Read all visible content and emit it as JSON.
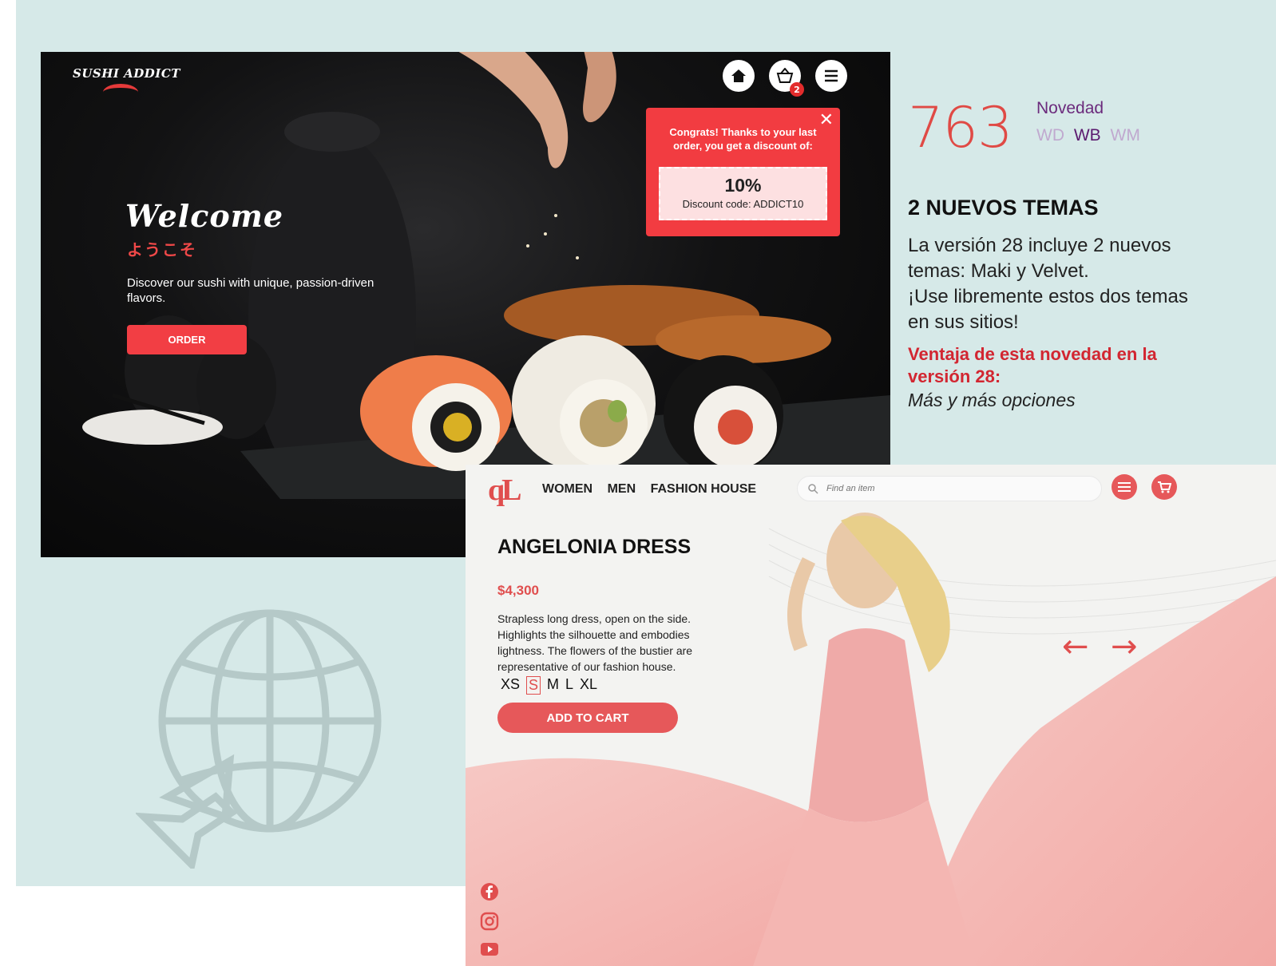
{
  "sushi_site": {
    "logo": "SUSHI ADDICT",
    "welcome": "Welcome",
    "welcome_jp": "ようこそ",
    "tagline": "Discover our sushi with unique, passion-driven flavors.",
    "order_label": "ORDER",
    "cart_count": "2",
    "icons": [
      "home-icon",
      "basket-icon",
      "menu-icon"
    ],
    "popup": {
      "close": "✕",
      "message": "Congrats! Thanks to your last order, you get a discount of:",
      "percent": "10%",
      "code": "Discount code: ADDICT10"
    },
    "accent_color": "#f23e44"
  },
  "info": {
    "number": "763",
    "novedad": "Novedad",
    "variants": [
      "WD",
      "WB",
      "WM"
    ],
    "variant_active": "WB",
    "heading": "2 NUEVOS TEMAS",
    "body_line1": "La versión 28 incluye 2 nuevos temas: Maki y Velvet.",
    "body_line2": "¡Use libremente estos dos temas en sus sitios!",
    "advantage": "Ventaja de esta novedad en la versión 28:",
    "advantage_detail": "Más y más opciones",
    "number_color": "#e04a45",
    "advantage_color": "#d22631"
  },
  "globe": {
    "icon": "globe-cursor-icon"
  },
  "fashion_site": {
    "logo": "qL",
    "nav": [
      "WOMEN",
      "MEN",
      "FASHION HOUSE"
    ],
    "search_placeholder": "Find an item",
    "product_title": "ANGELONIA DRESS",
    "price": "$4,300",
    "description": "Strapless long dress, open on the side. Highlights the silhouette and embodies lightness. The flowers of the bustier are representative of our fashion house.",
    "sizes": [
      "XS",
      "S",
      "M",
      "L",
      "XL"
    ],
    "selected_size": "S",
    "add_to_cart": "ADD TO CART",
    "prev_arrow": "←",
    "next_arrow": "→",
    "social_icons": [
      "facebook-icon",
      "instagram-icon",
      "youtube-icon"
    ],
    "accent_color": "#e6585a"
  }
}
